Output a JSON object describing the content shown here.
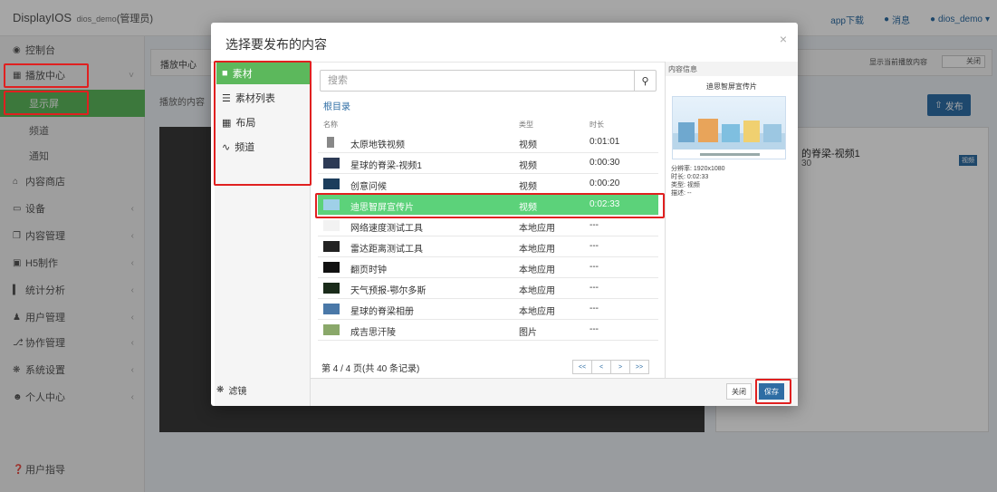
{
  "topbar": {
    "brand": "DisplayIOS",
    "user_sub": "dios_demo",
    "role": "(管理员)",
    "app_download": "app下载",
    "messages": "消息",
    "username": "dios_demo"
  },
  "sidebar": {
    "items": [
      {
        "label": "控制台",
        "icon": "dashboard-icon"
      },
      {
        "label": "播放中心",
        "icon": "grid-icon"
      },
      {
        "label": "显示屏"
      },
      {
        "label": "频道"
      },
      {
        "label": "通知"
      },
      {
        "label": "内容商店",
        "icon": "bank-icon"
      },
      {
        "label": "设备",
        "icon": "monitor-icon"
      },
      {
        "label": "内容管理",
        "icon": "copy-icon"
      },
      {
        "label": "H5制作",
        "icon": "h5-icon"
      },
      {
        "label": "统计分析",
        "icon": "bar-chart-icon"
      },
      {
        "label": "用户管理",
        "icon": "users-icon"
      },
      {
        "label": "协作管理",
        "icon": "fork-icon"
      },
      {
        "label": "系统设置",
        "icon": "gear-icon"
      },
      {
        "label": "个人中心",
        "icon": "user-circle-icon"
      },
      {
        "label": "用户指导",
        "icon": "question-icon"
      }
    ]
  },
  "main": {
    "panel_title": "播放中心",
    "publish_label": "播放的内容",
    "show_current_label": "显示当前播放内容",
    "toggle_label": "关闭",
    "publish_button": "发布",
    "card_title": "的脊梁-视频1",
    "card_sub": "30",
    "card_badge": "视频"
  },
  "modal": {
    "title": "选择要发布的内容",
    "nav": [
      {
        "label": "素材",
        "icon": "folder-icon"
      },
      {
        "label": "素材列表",
        "icon": "list-icon"
      },
      {
        "label": "布局",
        "icon": "grid-icon"
      },
      {
        "label": "频道",
        "icon": "rss-icon"
      }
    ],
    "filter_label": "滤镜",
    "search_placeholder": "搜索",
    "root_link": "根目录",
    "columns": {
      "name": "名称",
      "type": "类型",
      "duration": "时长"
    },
    "rows": [
      {
        "name": "太原地铁视频",
        "type": "视频",
        "duration": "0:01:01"
      },
      {
        "name": "星球的脊梁-视频1",
        "type": "视频",
        "duration": "0:00:30"
      },
      {
        "name": "创意问候",
        "type": "视频",
        "duration": "0:00:20"
      },
      {
        "name": "迪思智屏宣传片",
        "type": "视频",
        "duration": "0:02:33"
      },
      {
        "name": "网络速度测试工具",
        "type": "本地应用",
        "duration": "---"
      },
      {
        "name": "雷达距离测试工具",
        "type": "本地应用",
        "duration": "---"
      },
      {
        "name": "翻页时钟",
        "type": "本地应用",
        "duration": "---"
      },
      {
        "name": "天气预报-鄂尔多斯",
        "type": "本地应用",
        "duration": "---"
      },
      {
        "name": "星球的脊梁相册",
        "type": "本地应用",
        "duration": "---"
      },
      {
        "name": "成吉思汗陵",
        "type": "图片",
        "duration": "---"
      }
    ],
    "pagination_text": "第 4 / 4 页(共 40 条记录)",
    "pager": [
      "<<",
      "<",
      ">",
      ">>"
    ],
    "info": {
      "header": "内容信息",
      "name": "迪思智屏宣传片",
      "resolution": "分辨率: 1920x1080",
      "duration": "时长: 0:02:33",
      "type": "类型: 视频",
      "description": "描述: --"
    },
    "close_button": "关闭",
    "save_button": "保存"
  },
  "colors": {
    "accent_green": "#5cb85c",
    "primary_blue": "#2e6da4",
    "highlight_red": "#e02020"
  }
}
